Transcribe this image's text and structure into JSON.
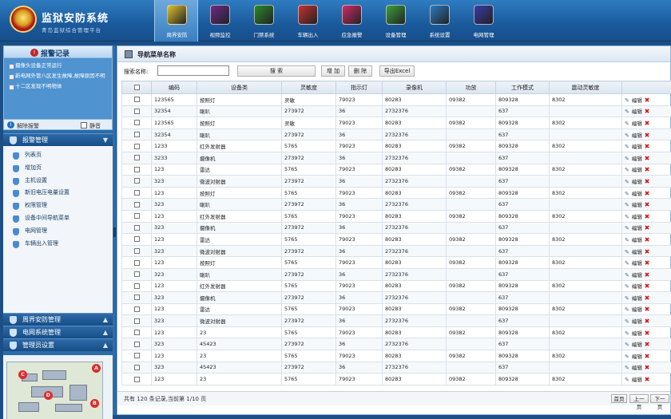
{
  "app": {
    "title": "监狱安防系统",
    "subtitle": "青岛监狱综合管理平台"
  },
  "nav": [
    {
      "label": "周界安防",
      "icon": "shield-icon",
      "color": "#e0c030",
      "active": true
    },
    {
      "label": "视频监控",
      "icon": "camera-icon",
      "color": "#6a2a8a",
      "active": false
    },
    {
      "label": "门禁系统",
      "icon": "door-icon",
      "color": "#2a8a2a",
      "active": false
    },
    {
      "label": "车辆出入",
      "icon": "vehicle-icon",
      "color": "#c83030",
      "active": false
    },
    {
      "label": "应急报警",
      "icon": "alarm-icon",
      "color": "#d02a6a",
      "active": false
    },
    {
      "label": "设备管理",
      "icon": "device-icon",
      "color": "#3aa03a",
      "active": false
    },
    {
      "label": "系统设置",
      "icon": "settings-icon",
      "color": "#2a7ac0",
      "active": false
    },
    {
      "label": "电网管理",
      "icon": "power-icon",
      "color": "#3a3aa8",
      "active": false
    }
  ],
  "alarm": {
    "title": "报警记录",
    "items": [
      "摄像头设备正常运行",
      "新电网外管八区发生故障,故障原因不明",
      "十二区发现不明物体"
    ],
    "dismiss_label": "解除报警",
    "mute_label": "静音"
  },
  "sidebar": {
    "section_title": "报警管理",
    "menu": [
      "列表页",
      "增加页",
      "主机设置",
      "新旧电压电量设置",
      "权限管理",
      "设备中间导航菜单",
      "电网管理",
      "车辆出入管理"
    ],
    "bottom_sections": [
      "周界安防管理",
      "电网系统管理",
      "管理员设置"
    ]
  },
  "minimap": {
    "pins": [
      "A",
      "B",
      "C",
      "D"
    ]
  },
  "main": {
    "title": "导航菜单名称",
    "search_label": "搜索名称:",
    "search_placeholder": "",
    "buttons": {
      "search": "搜 索",
      "add": "增 加",
      "delete": "删 除",
      "export": "导出Excel"
    }
  },
  "table": {
    "columns": [
      "编码",
      "设备类",
      "灵敏度",
      "指示灯",
      "录像机",
      "功放",
      "工作模式",
      "震动灵敏度"
    ],
    "rows": [
      [
        "123565",
        "按照灯",
        "灵敏",
        "79023",
        "80283",
        "09382",
        "809328",
        "8302"
      ],
      [
        "32354",
        "喇叭",
        "273972",
        "36",
        "2732376",
        "",
        "637",
        ""
      ],
      [
        "123565",
        "按照灯",
        "灵敏",
        "79023",
        "80283",
        "09382",
        "809328",
        "8302"
      ],
      [
        "32354",
        "喇叭",
        "273972",
        "36",
        "2732376",
        "",
        "637",
        ""
      ],
      [
        "1233",
        "红外发射器",
        "5765",
        "79023",
        "80283",
        "09382",
        "809328",
        "8302"
      ],
      [
        "3233",
        "摄像机",
        "273972",
        "36",
        "2732376",
        "",
        "637",
        ""
      ],
      [
        "123",
        "雷达",
        "5765",
        "79023",
        "80283",
        "09382",
        "809328",
        "8302"
      ],
      [
        "323",
        "微波对射器",
        "273972",
        "36",
        "2732376",
        "",
        "637",
        ""
      ],
      [
        "123",
        "按照灯",
        "5765",
        "79023",
        "80283",
        "09382",
        "809328",
        "8302"
      ],
      [
        "323",
        "喇叭",
        "273972",
        "36",
        "2732376",
        "",
        "637",
        ""
      ],
      [
        "123",
        "红外发射器",
        "5765",
        "79023",
        "80283",
        "09382",
        "809328",
        "8302"
      ],
      [
        "323",
        "摄像机",
        "273972",
        "36",
        "2732376",
        "",
        "637",
        ""
      ],
      [
        "123",
        "雷达",
        "5765",
        "79023",
        "80283",
        "09382",
        "809328",
        "8302"
      ],
      [
        "323",
        "微波对射器",
        "273972",
        "36",
        "2732376",
        "",
        "637",
        ""
      ],
      [
        "123",
        "按照灯",
        "5765",
        "79023",
        "80283",
        "09382",
        "809328",
        "8302"
      ],
      [
        "323",
        "喇叭",
        "273972",
        "36",
        "2732376",
        "",
        "637",
        ""
      ],
      [
        "123",
        "红外发射器",
        "5765",
        "79023",
        "80283",
        "09382",
        "809328",
        "8302"
      ],
      [
        "323",
        "摄像机",
        "273972",
        "36",
        "2732376",
        "",
        "637",
        ""
      ],
      [
        "123",
        "雷达",
        "5765",
        "79023",
        "80283",
        "09382",
        "809328",
        "8302"
      ],
      [
        "323",
        "微波对射器",
        "273972",
        "36",
        "2732376",
        "",
        "637",
        ""
      ],
      [
        "123",
        "23",
        "5765",
        "79023",
        "80283",
        "09382",
        "809328",
        "8302"
      ],
      [
        "323",
        "45423",
        "273972",
        "36",
        "2732376",
        "",
        "637",
        ""
      ],
      [
        "123",
        "23",
        "5765",
        "79023",
        "80283",
        "09382",
        "809328",
        "8302"
      ],
      [
        "323",
        "45423",
        "273972",
        "36",
        "2732376",
        "",
        "637",
        ""
      ],
      [
        "123",
        "23",
        "5765",
        "79023",
        "80283",
        "09382",
        "809328",
        "8302"
      ]
    ],
    "edit_label": "编辑"
  },
  "footer": {
    "info": "共有 120 条记录,当前第 1/10 页",
    "first": "首页",
    "prev": "上一页",
    "next": "下一页"
  }
}
